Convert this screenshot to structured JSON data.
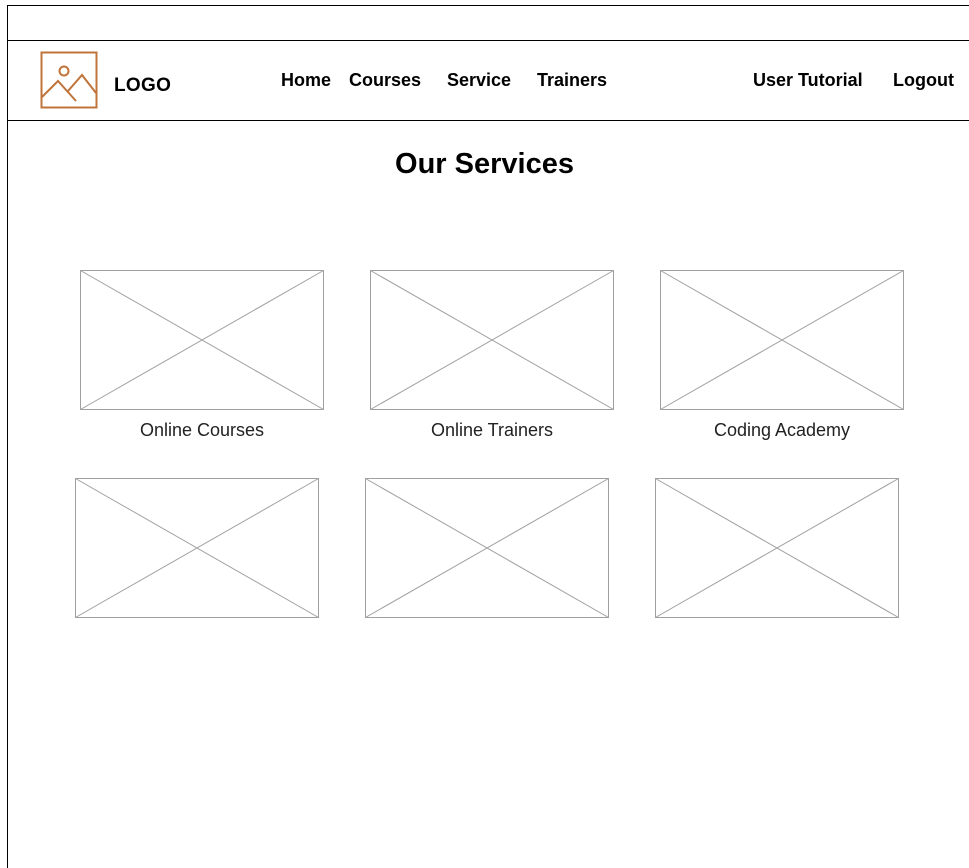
{
  "header": {
    "logo_text": "LOGO",
    "logo_icon": "image-icon",
    "accent_color": "#c0743a",
    "nav": [
      {
        "label": "Home"
      },
      {
        "label": "Courses"
      },
      {
        "label": "Service"
      },
      {
        "label": "Trainers"
      }
    ],
    "user_links": [
      {
        "label": "User Tutorial"
      },
      {
        "label": "Logout"
      }
    ]
  },
  "main": {
    "title": "Our Services",
    "cards": [
      {
        "label": "Online Courses"
      },
      {
        "label": "Online Trainers"
      },
      {
        "label": "Coding Academy"
      },
      {
        "label": ""
      },
      {
        "label": ""
      },
      {
        "label": ""
      }
    ]
  }
}
